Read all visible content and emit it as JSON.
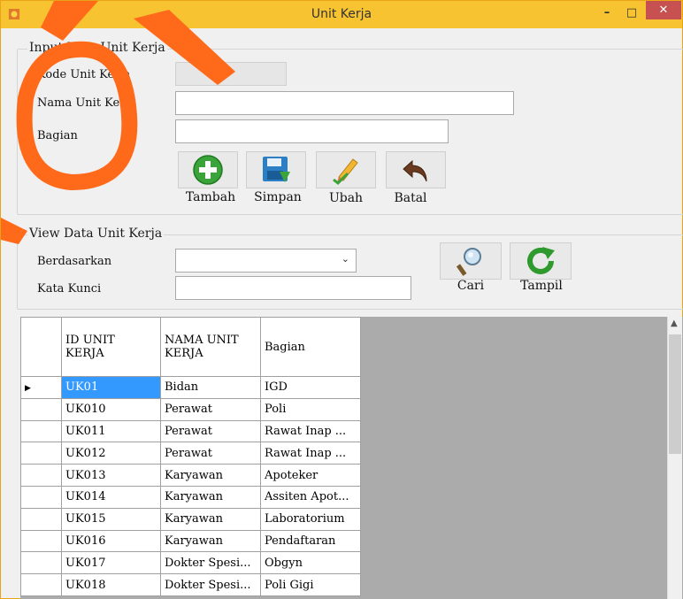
{
  "window": {
    "title": "Unit Kerja",
    "controls": {
      "minimize": "–",
      "maximize": "□",
      "close": "✕"
    }
  },
  "input_group": {
    "legend": "Input Data Unit Kerja",
    "kode_label": "Kode Unit Kerja",
    "nama_label": "Nama Unit Kerja",
    "bagian_label": "Bagian",
    "kode_value": "",
    "nama_value": "",
    "bagian_value": "",
    "buttons": {
      "tambah": "Tambah",
      "simpan": "Simpan",
      "ubah": "Ubah",
      "batal": "Batal"
    }
  },
  "view_group": {
    "legend": "View Data Unit Kerja",
    "berdasarkan_label": "Berdasarkan",
    "kata_kunci_label": "Kata Kunci",
    "berdasarkan_value": "",
    "kata_kunci_value": "",
    "buttons": {
      "cari": "Cari",
      "tampil": "Tampil"
    }
  },
  "grid": {
    "columns": [
      "ID UNIT KERJA",
      "NAMA UNIT KERJA",
      "Bagian"
    ],
    "rows": [
      [
        "UK01",
        "Bidan",
        "IGD"
      ],
      [
        "UK010",
        "Perawat",
        "Poli"
      ],
      [
        "UK011",
        "Perawat",
        "Rawat Inap ..."
      ],
      [
        "UK012",
        "Perawat",
        "Rawat Inap ..."
      ],
      [
        "UK013",
        "Karyawan",
        "Apoteker"
      ],
      [
        "UK014",
        "Karyawan",
        "Assiten Apot..."
      ],
      [
        "UK015",
        "Karyawan",
        "Laboratorium"
      ],
      [
        "UK016",
        "Karyawan",
        "Pendaftaran"
      ],
      [
        "UK017",
        "Dokter Spesi...",
        "Obgyn"
      ],
      [
        "UK018",
        "Dokter Spesi...",
        "Poli Gigi"
      ]
    ],
    "current_row_marker": "▶"
  },
  "colors": {
    "titlebar": "#f7c331",
    "close": "#c75050",
    "selection": "#3399ff",
    "grid_bg": "#ababab"
  }
}
